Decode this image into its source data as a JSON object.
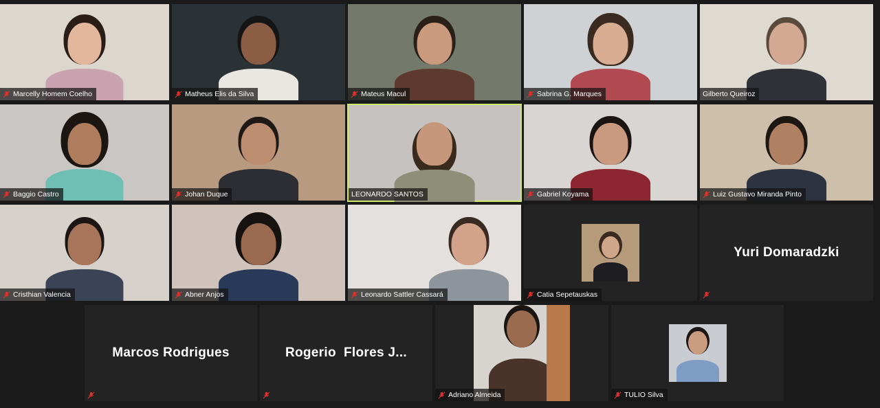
{
  "participants": [
    {
      "name": "Marcelly Homem Coelho"
    },
    {
      "name": "Matheus Elis da Silva"
    },
    {
      "name": "Mateus Macul"
    },
    {
      "name": "Sabrina G. Marques"
    },
    {
      "name": "Gilberto Queiroz"
    },
    {
      "name": "Baggio Castro"
    },
    {
      "name": "Johan Duque"
    },
    {
      "name": "LEONARDO SANTOS"
    },
    {
      "name": "Gabriel Koyama"
    },
    {
      "name": "Luiz Gustavo Miranda Pinto"
    },
    {
      "name": "Cristhian Valencia"
    },
    {
      "name": "Abner Anjos"
    },
    {
      "name": "Leonardo Sattler Cassará"
    },
    {
      "name": "Catia Sepetauskas"
    },
    {
      "name": "Yuri Domaradzki"
    },
    {
      "name": "Marcos Rodrigues"
    },
    {
      "name": "Rogerio  Flores J..."
    },
    {
      "name": "Adriano Almeida"
    },
    {
      "name": "TULIO Silva"
    }
  ],
  "active_speaker_color": "#cfe86a",
  "mute_icon": "microphone-muted-icon",
  "mute_color": "#e0312e"
}
